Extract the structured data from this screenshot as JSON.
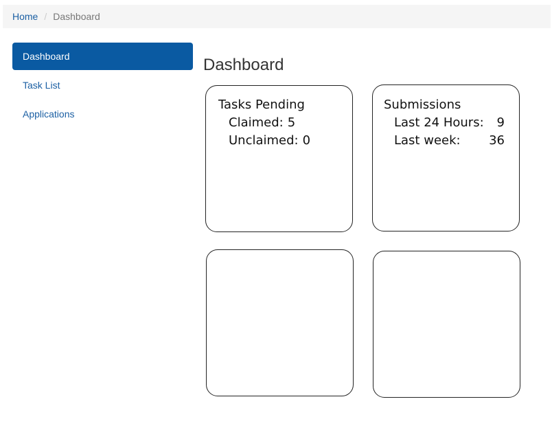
{
  "breadcrumb": {
    "home": "Home",
    "separator": "/",
    "current": "Dashboard"
  },
  "sidebar": {
    "items": [
      {
        "label": "Dashboard",
        "active": true
      },
      {
        "label": "Task List",
        "active": false
      },
      {
        "label": "Applications",
        "active": false
      }
    ]
  },
  "main": {
    "title": "Dashboard",
    "tasks_card": {
      "title": "Tasks Pending",
      "rows": [
        {
          "label": "Claimed:",
          "value": "5"
        },
        {
          "label": "Unclaimed:",
          "value": "0"
        }
      ]
    },
    "submissions_card": {
      "title": "Submissions",
      "rows": [
        {
          "label": "Last 24 Hours:",
          "value": "9"
        },
        {
          "label": "Last week:",
          "value": "36"
        }
      ]
    }
  },
  "colors": {
    "accent": "#0a5aa2",
    "link": "#1b5fa3",
    "breadcrumb_bg": "#f5f5f5"
  }
}
